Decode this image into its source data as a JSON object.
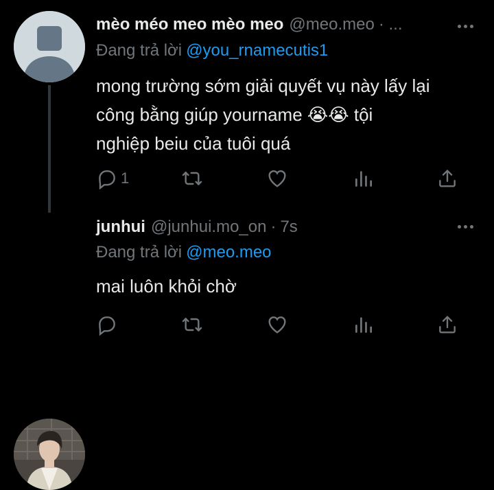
{
  "tweets": [
    {
      "name": "mèo méo meo mèo meo",
      "handle": "@meo.meo",
      "time": "",
      "separator": "· ...",
      "reply_prefix": "Đang trả lời",
      "reply_to": "@you_rnamecutis1",
      "text_lines": [
        "mong trường sớm giải quyết vụ này lấy lại",
        "công bằng giúp yourname 😭😭 tội",
        "nghiệp beiu của tuôi quá"
      ],
      "reply_count": "1",
      "avatar": "default-avatar"
    },
    {
      "name": "junhui",
      "handle": "@junhui.mo_on",
      "separator": "·",
      "time": "7s",
      "reply_prefix": "Đang trả lời",
      "reply_to": "@meo.meo",
      "text_lines": [
        "mai luôn khỏi chờ"
      ],
      "reply_count": "",
      "avatar": "photo-avatar"
    }
  ],
  "icons": [
    "reply-icon",
    "retweet-icon",
    "like-icon",
    "views-icon",
    "share-icon",
    "more-icon"
  ],
  "colors": {
    "background": "#000000",
    "text": "#e7e9ea",
    "muted": "#71767b",
    "link": "#1d9bf0"
  }
}
